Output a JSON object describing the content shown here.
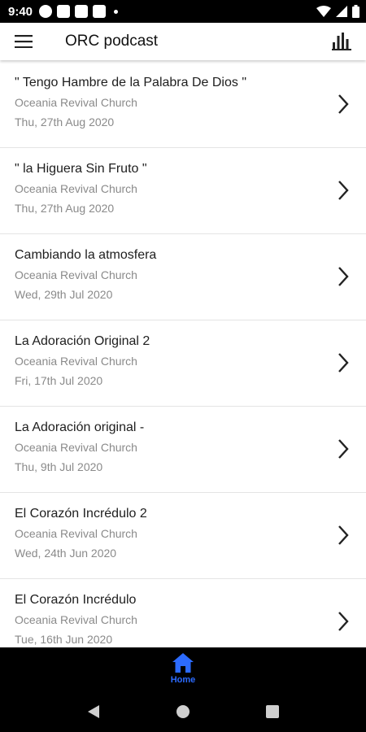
{
  "status_bar": {
    "time": "9:40",
    "left_icons": [
      "circle-icon",
      "square-icon",
      "square-icon",
      "square-icon",
      "dot-icon"
    ],
    "right_icons": [
      "wifi-icon",
      "signal-icon",
      "battery-icon"
    ]
  },
  "app_bar": {
    "title": "ORC podcast",
    "menu_icon": "hamburger-menu-icon",
    "action_icon": "bar-chart-icon"
  },
  "episodes": [
    {
      "title": "\" Tengo Hambre de la Palabra De Dios \"",
      "author": "Oceania Revival Church",
      "date": "Thu, 27th Aug 2020"
    },
    {
      "title": "\" la Higuera Sin Fruto \"",
      "author": "Oceania Revival Church",
      "date": "Thu, 27th Aug 2020"
    },
    {
      "title": "Cambiando la atmosfera",
      "author": "Oceania Revival Church",
      "date": "Wed, 29th Jul 2020"
    },
    {
      "title": "La Adoración Original 2",
      "author": "Oceania Revival Church",
      "date": "Fri, 17th Jul 2020"
    },
    {
      "title": "La Adoración original -",
      "author": "Oceania Revival Church",
      "date": "Thu, 9th Jul 2020"
    },
    {
      "title": "El Corazón Incrédulo 2",
      "author": "Oceania Revival Church",
      "date": "Wed, 24th Jun 2020"
    },
    {
      "title": "El Corazón Incrédulo",
      "author": "Oceania Revival Church",
      "date": "Tue, 16th Jun 2020"
    }
  ],
  "bottom_nav": {
    "home_label": "Home",
    "home_icon": "home-icon",
    "active_color": "#2c6bff"
  },
  "system_nav": [
    "back-icon",
    "home-circle-icon",
    "recents-icon"
  ]
}
